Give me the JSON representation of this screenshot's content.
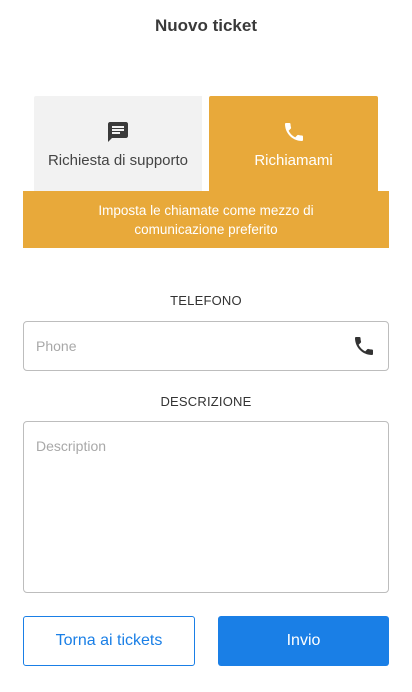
{
  "header": {
    "title": "Nuovo ticket"
  },
  "tabs": [
    {
      "label": "Richiesta di supporto",
      "icon": "message-icon",
      "selected": false
    },
    {
      "label": "Richiamami",
      "icon": "phone-icon",
      "selected": true
    }
  ],
  "banner": {
    "text": "Imposta le chiamate come mezzo di comunicazione preferito"
  },
  "phone": {
    "label": "TELEFONO",
    "placeholder": "Phone",
    "value": "",
    "icon": "phone-icon"
  },
  "description": {
    "label": "DESCRIZIONE",
    "placeholder": "Description",
    "value": ""
  },
  "actions": {
    "back_label": "Torna ai tickets",
    "send_label": "Invio"
  },
  "colors": {
    "accent": "#e8a93a",
    "primary": "#1a7fe6",
    "tab_inactive": "#f2f2f2"
  }
}
